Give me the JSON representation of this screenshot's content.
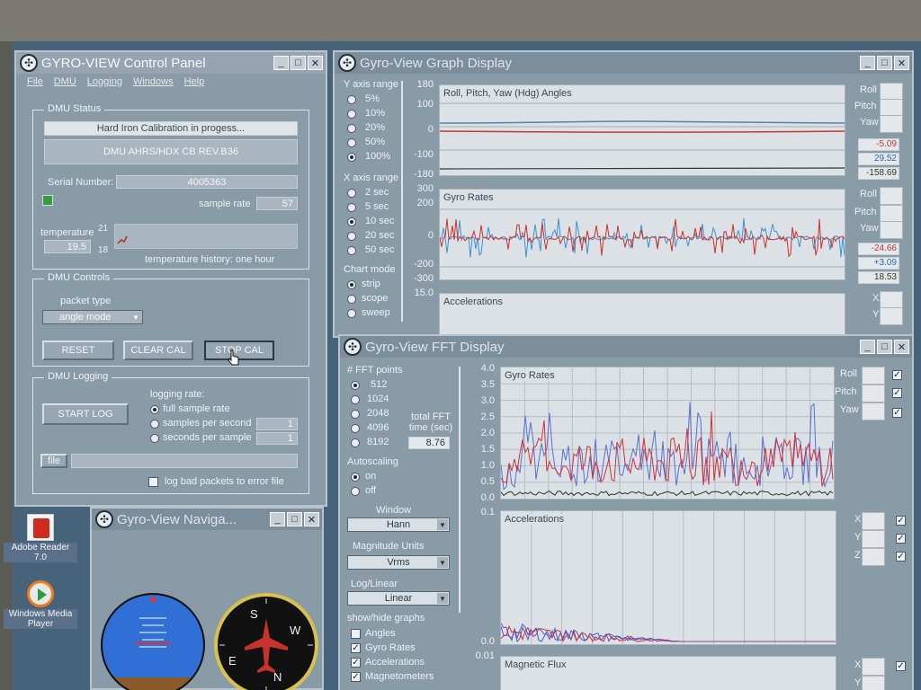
{
  "control_panel": {
    "title": "GYRO-VIEW Control Panel",
    "menu": [
      "File",
      "DMU",
      "Logging",
      "Windows",
      "Help"
    ],
    "dmu_status": {
      "group_label": "DMU Status",
      "status_message": "Hard Iron Calibration in progess...",
      "device_info": "DMU AHRS/HDX CB REV.B36",
      "serial_label": "Serial Number:",
      "serial_value": "4005363",
      "sample_rate_label": "sample rate",
      "sample_rate_value": "57",
      "temperature_label": "temperature",
      "temperature_value": "19.5",
      "temp_max_tick": "21",
      "temp_min_tick": "18",
      "temp_history_label": "temperature history: one hour"
    },
    "dmu_controls": {
      "group_label": "DMU Controls",
      "packet_type_label": "packet type",
      "packet_type_value": "angle mode",
      "reset_label": "RESET",
      "clear_cal_label": "CLEAR CAL",
      "stop_cal_label": "STOP CAL"
    },
    "dmu_logging": {
      "group_label": "DMU Logging",
      "start_log_label": "START LOG",
      "logging_rate_label": "logging rate:",
      "options": [
        "full sample rate",
        "samples per second",
        "seconds per sample"
      ],
      "selected_option": "full sample rate",
      "samples_per_second": "1",
      "seconds_per_sample": "1",
      "file_label": "file",
      "bad_packets_label": "log bad packets to error file"
    }
  },
  "graph_window": {
    "title": "Gyro-View Graph Display",
    "y_axis_range_label": "Y axis range",
    "y_axis_options": [
      "5%",
      "10%",
      "20%",
      "50%",
      "100%"
    ],
    "y_axis_selected": "100%",
    "x_axis_range_label": "X axis range",
    "x_axis_options": [
      "2 sec",
      "5 sec",
      "10 sec",
      "20 sec",
      "50 sec"
    ],
    "x_axis_selected": "10 sec",
    "chart_mode_label": "Chart mode",
    "chart_mode_options": [
      "strip",
      "scope",
      "sweep"
    ],
    "chart_mode_selected": "strip",
    "angles_plot": {
      "title": "Roll, Pitch, Yaw (Hdg) Angles",
      "yticks": [
        "180",
        "100",
        "0",
        "-100",
        "-180"
      ],
      "legend": [
        "Roll",
        "Pitch",
        "Yaw"
      ],
      "readouts": [
        "-5.09",
        "29.52",
        "-158.69"
      ]
    },
    "rates_plot": {
      "title": "Gyro Rates",
      "yticks": [
        "300",
        "200",
        "0",
        "-200",
        "-300"
      ],
      "legend": [
        "Roll",
        "Pitch",
        "Yaw"
      ],
      "readouts": [
        "-24.66",
        "+3.09",
        "18.53"
      ]
    },
    "accel_plot": {
      "title": "Accelerations",
      "yticks": [
        "15.0"
      ],
      "legend": [
        "X",
        "Y"
      ]
    }
  },
  "fft_window": {
    "title": "Gyro-View FFT Display",
    "fft_points_label": "# FFT points",
    "fft_points_options": [
      "512",
      "1024",
      "2048",
      "4096",
      "8192"
    ],
    "fft_points_selected": "512",
    "total_fft_label": "total FFT time (sec)",
    "total_fft_value": "8.76",
    "autoscaling_label": "Autoscaling",
    "autoscaling_options": [
      "on",
      "off"
    ],
    "autoscaling_selected": "on",
    "window_label": "Window",
    "window_value": "Hann",
    "magnitude_units_label": "Magnitude Units",
    "magnitude_units_value": "Vrms",
    "log_linear_label": "Log/Linear",
    "log_linear_value": "Linear",
    "show_hide_label": "show/hide graphs",
    "graph_toggles": [
      {
        "label": "Angles",
        "checked": false
      },
      {
        "label": "Gyro Rates",
        "checked": true
      },
      {
        "label": "Accelerations",
        "checked": true
      },
      {
        "label": "Magnetometers",
        "checked": true
      }
    ],
    "gyro_plot": {
      "title": "Gyro Rates",
      "yticks": [
        "4.0",
        "3.5",
        "3.0",
        "2.5",
        "2.0",
        "1.5",
        "1.0",
        "0.5",
        "0.0"
      ],
      "legend": [
        "Roll",
        "Pitch",
        "Yaw"
      ]
    },
    "accel_plot": {
      "title": "Accelerations",
      "yticks": [
        "0.1",
        "0.0"
      ],
      "legend": [
        "X",
        "Y",
        "Z"
      ]
    },
    "mag_plot": {
      "title": "Magnetic Flux",
      "yticks": [
        "0.01"
      ],
      "legend": [
        "X",
        "Y"
      ]
    }
  },
  "nav_window": {
    "title": "Gyro-View Naviga...",
    "compass_letters": [
      "S",
      "W",
      "E",
      "N"
    ]
  },
  "desktop_icons": [
    {
      "label": "Adobe Reader 7.0",
      "icon": "adobe-reader-icon"
    },
    {
      "label": "Windows Media Player",
      "icon": "media-player-icon"
    }
  ]
}
